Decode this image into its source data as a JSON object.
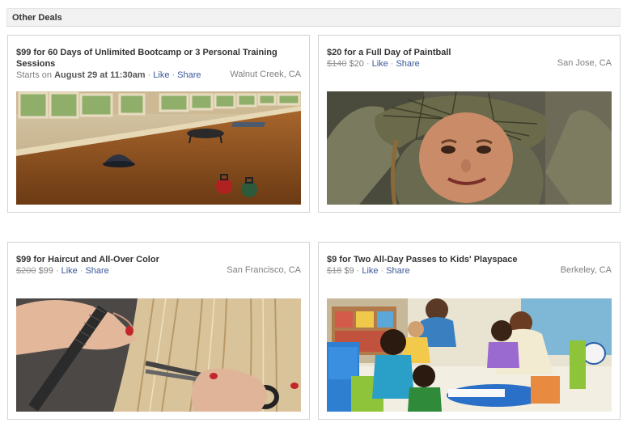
{
  "section": {
    "title": "Other Deals"
  },
  "deals": [
    {
      "title": "$99 for 60 Days of Unlimited Bootcamp or 3 Personal Training Sessions",
      "starts_prefix": "Starts on",
      "starts_date": "August 29 at 11:30am",
      "like": "Like",
      "share": "Share",
      "location": "Walnut Creek, CA",
      "image": "gym-interior-photo"
    },
    {
      "title": "$20 for a Full Day of Paintball",
      "old_price": "$140",
      "new_price": "$20",
      "like": "Like",
      "share": "Share",
      "location": "San Jose, CA",
      "image": "paintball-player-photo"
    },
    {
      "title": "$99 for Haircut and All-Over Color",
      "old_price": "$200",
      "new_price": "$99",
      "like": "Like",
      "share": "Share",
      "location": "San Francisco, CA",
      "image": "haircut-photo"
    },
    {
      "title": "$9 for Two All-Day Passes to Kids' Playspace",
      "old_price": "$18",
      "new_price": "$9",
      "like": "Like",
      "share": "Share",
      "location": "Berkeley, CA",
      "image": "kids-playspace-photo"
    }
  ],
  "colors": {
    "link": "#3b5998",
    "muted": "#808080",
    "header_bg": "#f2f2f2"
  }
}
